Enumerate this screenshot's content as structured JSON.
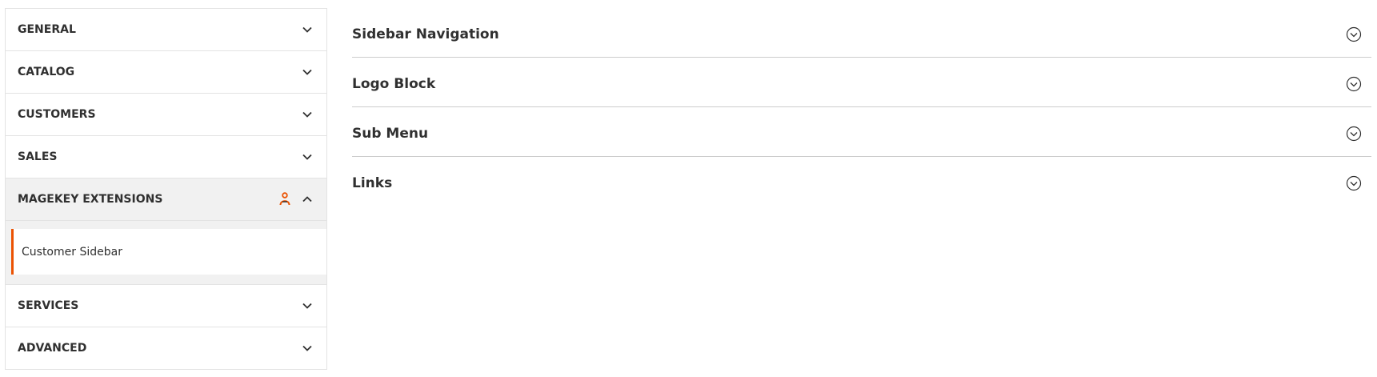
{
  "sidebar": {
    "sections": [
      {
        "label": "GENERAL"
      },
      {
        "label": "CATALOG"
      },
      {
        "label": "CUSTOMERS"
      },
      {
        "label": "SALES"
      },
      {
        "label": "MAGEKEY EXTENSIONS"
      },
      {
        "label": "SERVICES"
      },
      {
        "label": "ADVANCED"
      }
    ],
    "active_section": "MAGEKEY EXTENSIONS",
    "sub_items": [
      {
        "label": "Customer Sidebar"
      }
    ]
  },
  "main": {
    "groups": [
      {
        "title": "Sidebar Navigation"
      },
      {
        "title": "Logo Block"
      },
      {
        "title": "Sub Menu"
      },
      {
        "title": "Links"
      }
    ]
  },
  "colors": {
    "accent": "#eb5202",
    "active_bg": "#f1f1f1",
    "text": "#303030",
    "border": "#e3e3e3"
  },
  "icons": {
    "collapsed": "chevron-down-icon",
    "expanded": "chevron-up-icon",
    "brand": "magekey-logo-icon",
    "group_toggle": "circle-chevron-down-icon"
  }
}
